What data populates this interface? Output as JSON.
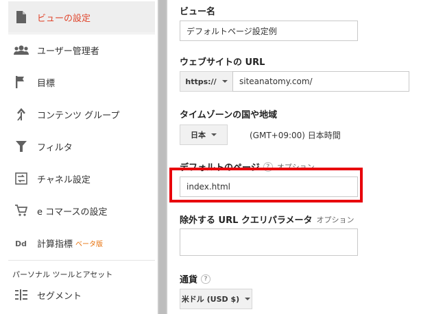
{
  "sidebar": {
    "items": [
      {
        "label": "ビューの設定",
        "icon": "document-icon",
        "active": true
      },
      {
        "label": "ユーザー管理者",
        "icon": "users-icon"
      },
      {
        "label": "目標",
        "icon": "flag-icon"
      },
      {
        "label": "コンテンツ グループ",
        "icon": "walk-icon"
      },
      {
        "label": "フィルタ",
        "icon": "filter-icon"
      },
      {
        "label": "チャネル設定",
        "icon": "channel-icon"
      },
      {
        "label": "e コマースの設定",
        "icon": "cart-icon"
      },
      {
        "label": "計算指標",
        "badge": "ベータ版",
        "icon": "dd-icon"
      }
    ],
    "section_header": "パーソナル ツールとアセット",
    "section_items": [
      {
        "label": "セグメント",
        "icon": "segment-icon"
      }
    ]
  },
  "form": {
    "view_name": {
      "label": "ビュー名",
      "value": "デフォルトページ設定例"
    },
    "website_url": {
      "label": "ウェブサイトの URL",
      "protocol": "https://",
      "value": "siteanatomy.com/"
    },
    "timezone": {
      "label": "タイムゾーンの国や地域",
      "country": "日本",
      "zone": "(GMT+09:00) 日本時間"
    },
    "default_page": {
      "label": "デフォルトのページ",
      "help": "?",
      "optional": "オプション",
      "value": "index.html"
    },
    "exclude_params": {
      "label": "除外する URL クエリパラメータ",
      "optional": "オプション",
      "value": ""
    },
    "currency": {
      "label": "通貨",
      "help": "?",
      "value": "米ドル (USD $)"
    }
  },
  "colors": {
    "active_text": "#e0452c",
    "highlight": "#e8000b",
    "beta": "#e8710a"
  }
}
